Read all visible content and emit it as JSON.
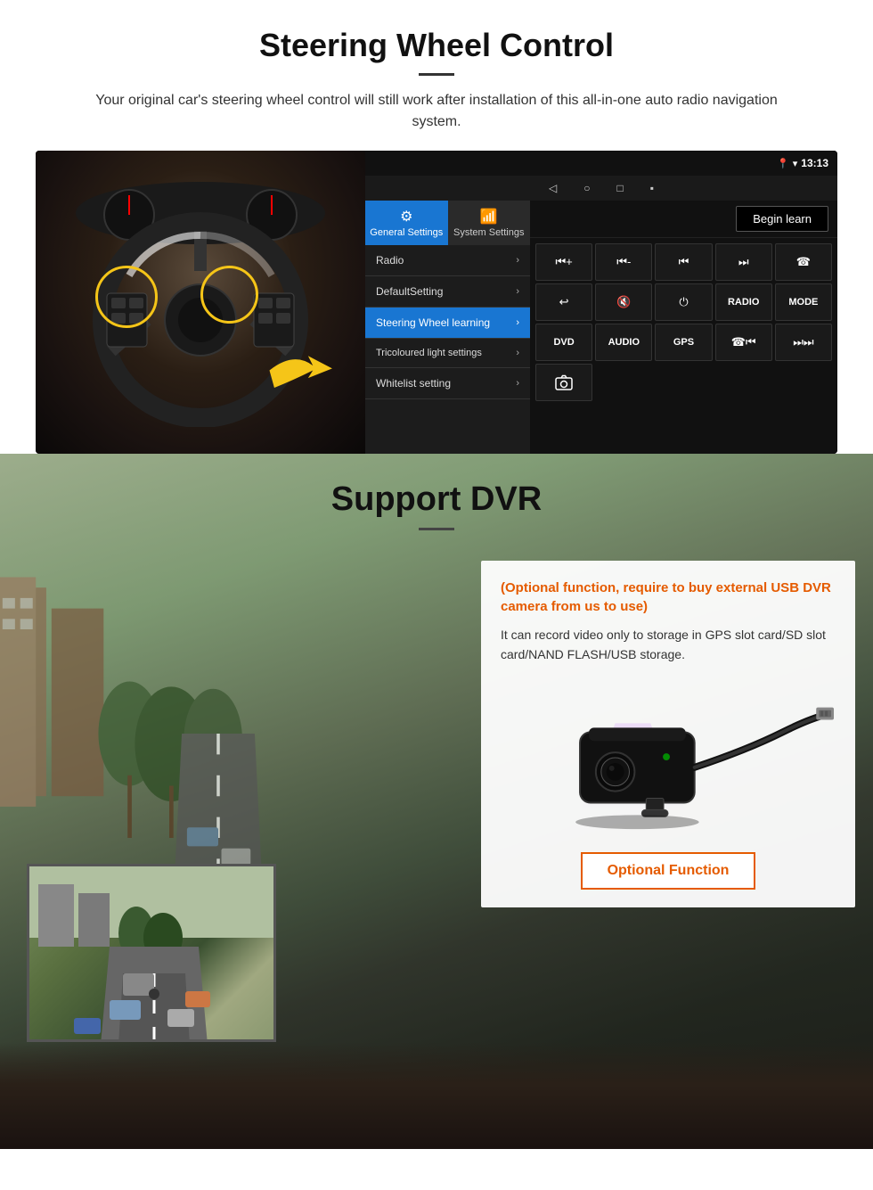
{
  "steering_section": {
    "title": "Steering Wheel Control",
    "subtitle": "Your original car's steering wheel control will still work after installation of this all-in-one auto radio navigation system.",
    "statusbar": {
      "time": "13:13",
      "wifi_icon": "▾",
      "signal_icon": "▾"
    },
    "tabs": {
      "general": "General Settings",
      "system": "System Settings"
    },
    "menu_items": [
      {
        "label": "Radio",
        "active": false
      },
      {
        "label": "DefaultSetting",
        "active": false
      },
      {
        "label": "Steering Wheel learning",
        "active": true
      },
      {
        "label": "Tricoloured light settings",
        "active": false
      },
      {
        "label": "Whitelist setting",
        "active": false
      }
    ],
    "begin_learn_label": "Begin learn",
    "control_buttons": [
      {
        "icon": "⏮+",
        "type": "icon"
      },
      {
        "icon": "⏮-",
        "type": "icon"
      },
      {
        "icon": "⏮",
        "type": "icon"
      },
      {
        "icon": "⏭",
        "type": "icon"
      },
      {
        "icon": "☎",
        "type": "icon"
      },
      {
        "icon": "↩",
        "type": "icon"
      },
      {
        "icon": "🔇",
        "type": "icon"
      },
      {
        "icon": "⏻",
        "type": "icon"
      },
      {
        "icon": "RADIO",
        "type": "text"
      },
      {
        "icon": "MODE",
        "type": "text"
      },
      {
        "icon": "DVD",
        "type": "text"
      },
      {
        "icon": "AUDIO",
        "type": "text"
      },
      {
        "icon": "GPS",
        "type": "text"
      },
      {
        "icon": "☎⏮",
        "type": "icon"
      },
      {
        "icon": "⏭⏭",
        "type": "icon"
      },
      {
        "icon": "📷",
        "type": "icon"
      }
    ]
  },
  "dvr_section": {
    "title": "Support DVR",
    "optional_text": "(Optional function, require to buy external USB DVR camera from us to use)",
    "description": "It can record video only to storage in GPS slot card/SD slot card/NAND FLASH/USB storage.",
    "optional_function_label": "Optional Function"
  }
}
